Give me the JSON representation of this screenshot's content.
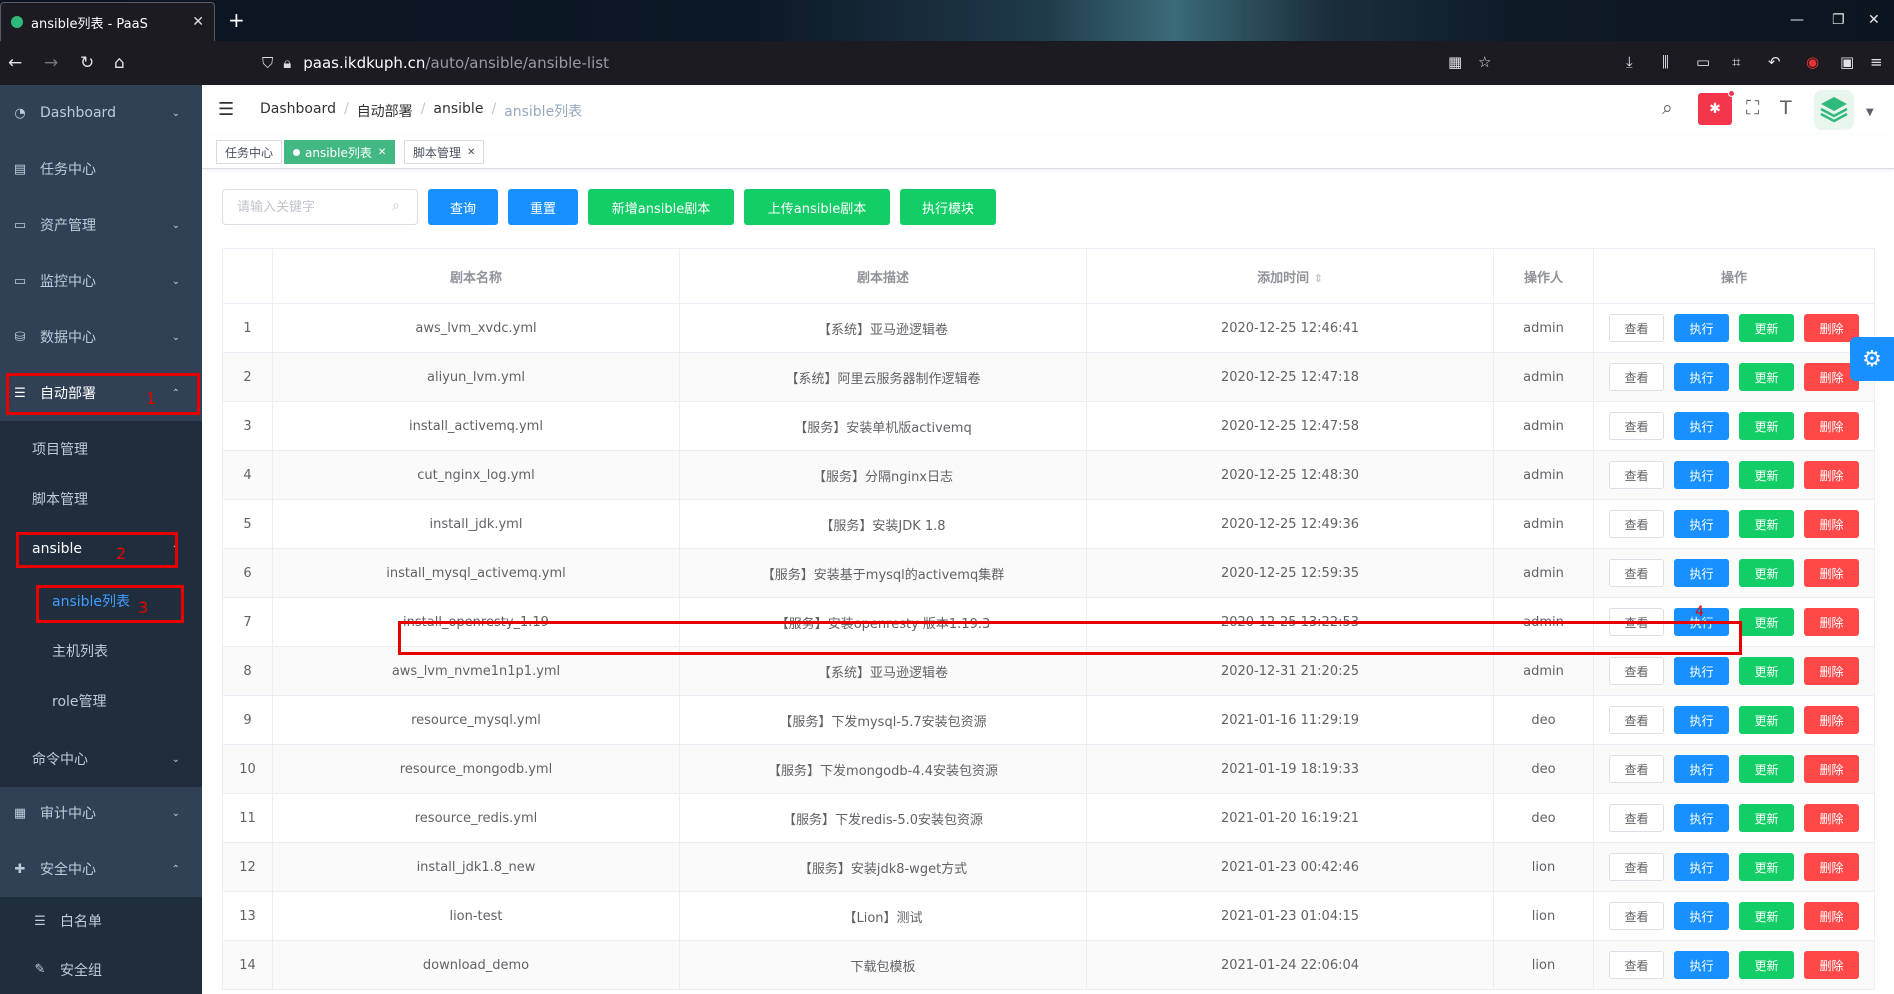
{
  "browser": {
    "tab_title": "ansible列表 - PaaS",
    "url_host": "paas.ikdkuph.cn",
    "url_path": "/auto/ansible/ansible-list"
  },
  "sidebar": {
    "items": [
      {
        "label": "Dashboard",
        "icon": "dashboard-icon",
        "arrow": "⌄"
      },
      {
        "label": "任务中心",
        "icon": "document-icon",
        "arrow": ""
      },
      {
        "label": "资产管理",
        "icon": "folder-icon",
        "arrow": "⌄"
      },
      {
        "label": "监控中心",
        "icon": "monitor-icon",
        "arrow": "⌄"
      },
      {
        "label": "数据中心",
        "icon": "database-icon",
        "arrow": "⌄"
      },
      {
        "label": "自动部署",
        "icon": "list-icon",
        "arrow": "⌃"
      }
    ],
    "auto_sub": {
      "project": "项目管理",
      "script": "脚本管理",
      "ansible": "ansible",
      "ansible_list": "ansible列表",
      "host_list": "主机列表",
      "role": "role管理",
      "command": "命令中心"
    },
    "audit": "审计中心",
    "security": "安全中心",
    "whitelist": "白名单",
    "security_group": "安全组",
    "annotations": [
      "1",
      "2",
      "3",
      "4"
    ]
  },
  "breadcrumb": [
    "Dashboard",
    "自动部署",
    "ansible",
    "ansible列表"
  ],
  "tags": [
    {
      "label": "任务中心",
      "active": false
    },
    {
      "label": "ansible列表",
      "active": true
    },
    {
      "label": "脚本管理",
      "active": false
    }
  ],
  "toolbar": {
    "search_placeholder": "请输入关键字",
    "query": "查询",
    "reset": "重置",
    "new_script": "新增ansible剧本",
    "upload_script": "上传ansible剧本",
    "exec_module": "执行模块"
  },
  "table": {
    "headers": [
      "",
      "剧本名称",
      "剧本描述",
      "添加时间",
      "操作人",
      "操作"
    ],
    "sort_icon": "⇕",
    "ops": {
      "view": "查看",
      "exec": "执行",
      "update": "更新",
      "delete": "删除"
    },
    "rows": [
      [
        "1",
        "aws_lvm_xvdc.yml",
        "【系统】亚马逊逻辑卷",
        "2020-12-25 12:46:41",
        "admin"
      ],
      [
        "2",
        "aliyun_lvm.yml",
        "【系统】阿里云服务器制作逻辑卷",
        "2020-12-25 12:47:18",
        "admin"
      ],
      [
        "3",
        "install_activemq.yml",
        "【服务】安装单机版activemq",
        "2020-12-25 12:47:58",
        "admin"
      ],
      [
        "4",
        "cut_nginx_log.yml",
        "【服务】分隔nginx日志",
        "2020-12-25 12:48:30",
        "admin"
      ],
      [
        "5",
        "install_jdk.yml",
        "【服务】安装JDK 1.8",
        "2020-12-25 12:49:36",
        "admin"
      ],
      [
        "6",
        "install_mysql_activemq.yml",
        "【服务】安装基于mysql的activemq集群",
        "2020-12-25 12:59:35",
        "admin"
      ],
      [
        "7",
        "install_openresty_1.19",
        "【服务】安装openresty 版本1.19.3",
        "2020-12-25 13:22:53",
        "admin"
      ],
      [
        "8",
        "aws_lvm_nvme1n1p1.yml",
        "【系统】亚马逊逻辑卷",
        "2020-12-31 21:20:25",
        "admin"
      ],
      [
        "9",
        "resource_mysql.yml",
        "【服务】下发mysql-5.7安装包资源",
        "2021-01-16 11:29:19",
        "deo"
      ],
      [
        "10",
        "resource_mongodb.yml",
        "【服务】下发mongodb-4.4安装包资源",
        "2021-01-19 18:19:33",
        "deo"
      ],
      [
        "11",
        "resource_redis.yml",
        "【服务】下发redis-5.0安装包资源",
        "2021-01-20 16:19:21",
        "deo"
      ],
      [
        "12",
        "install_jdk1.8_new",
        "【服务】安装jdk8-wget方式",
        "2021-01-23 00:42:46",
        "lion"
      ],
      [
        "13",
        "lion-test",
        "【Lion】测试",
        "2021-01-23 01:04:15",
        "lion"
      ],
      [
        "14",
        "download_demo",
        "下载包模板",
        "2021-01-24 22:06:04",
        "lion"
      ]
    ]
  },
  "colors": {
    "primary": "#1890ff",
    "success": "#13ce66",
    "danger": "#ff4949",
    "sidebar": "#304156",
    "annotation": "#e60000"
  }
}
